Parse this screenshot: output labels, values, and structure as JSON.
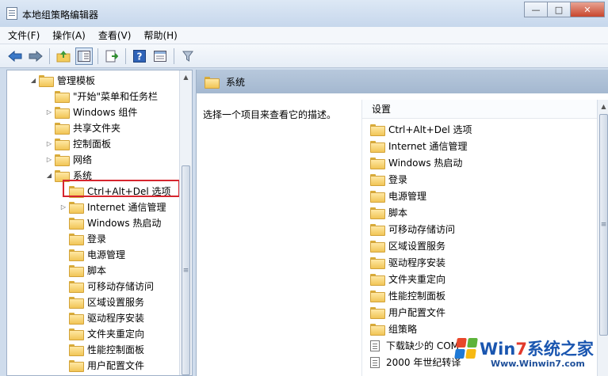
{
  "window": {
    "title": "本地组策略编辑器",
    "minimize_glyph": "—",
    "maximize_glyph": "□",
    "close_glyph": "✕"
  },
  "menu": [
    {
      "label": "文件(F)"
    },
    {
      "label": "操作(A)"
    },
    {
      "label": "查看(V)"
    },
    {
      "label": "帮助(H)"
    }
  ],
  "toolbar": {
    "icons": [
      "back-icon",
      "forward-icon",
      "up-folder-icon",
      "show-hide-tree-icon",
      "export-list-icon",
      "help-icon",
      "properties-icon",
      "filter-icon"
    ]
  },
  "tree": [
    {
      "label": "管理模板",
      "level": 0,
      "expander": "◢"
    },
    {
      "label": "\"开始\"菜单和任务栏",
      "level": 1,
      "expander": ""
    },
    {
      "label": "Windows 组件",
      "level": 1,
      "expander": "▷"
    },
    {
      "label": "共享文件夹",
      "level": 1,
      "expander": ""
    },
    {
      "label": "控制面板",
      "level": 1,
      "expander": "▷"
    },
    {
      "label": "网络",
      "level": 1,
      "expander": "▷"
    },
    {
      "label": "系统",
      "level": 1,
      "expander": "◢"
    },
    {
      "label": "Ctrl+Alt+Del 选项",
      "level": 2,
      "expander": "",
      "highlighted": true
    },
    {
      "label": "Internet 通信管理",
      "level": 2,
      "expander": "▷"
    },
    {
      "label": "Windows 热启动",
      "level": 2,
      "expander": ""
    },
    {
      "label": "登录",
      "level": 2,
      "expander": ""
    },
    {
      "label": "电源管理",
      "level": 2,
      "expander": ""
    },
    {
      "label": "脚本",
      "level": 2,
      "expander": ""
    },
    {
      "label": "可移动存储访问",
      "level": 2,
      "expander": ""
    },
    {
      "label": "区域设置服务",
      "level": 2,
      "expander": ""
    },
    {
      "label": "驱动程序安装",
      "level": 2,
      "expander": ""
    },
    {
      "label": "文件夹重定向",
      "level": 2,
      "expander": ""
    },
    {
      "label": "性能控制面板",
      "level": 2,
      "expander": ""
    },
    {
      "label": "用户配置文件",
      "level": 2,
      "expander": ""
    }
  ],
  "right_pane": {
    "header": "系统",
    "description": "选择一个项目来查看它的描述。",
    "column_header": "设置",
    "items": [
      {
        "label": "Ctrl+Alt+Del 选项",
        "icon": "folder"
      },
      {
        "label": "Internet 通信管理",
        "icon": "folder"
      },
      {
        "label": "Windows 热启动",
        "icon": "folder"
      },
      {
        "label": "登录",
        "icon": "folder"
      },
      {
        "label": "电源管理",
        "icon": "folder"
      },
      {
        "label": "脚本",
        "icon": "folder"
      },
      {
        "label": "可移动存储访问",
        "icon": "folder"
      },
      {
        "label": "区域设置服务",
        "icon": "folder"
      },
      {
        "label": "驱动程序安装",
        "icon": "folder"
      },
      {
        "label": "文件夹重定向",
        "icon": "folder"
      },
      {
        "label": "性能控制面板",
        "icon": "folder"
      },
      {
        "label": "用户配置文件",
        "icon": "folder"
      },
      {
        "label": "组策略",
        "icon": "folder"
      },
      {
        "label": "下载缺少的 COM",
        "icon": "setting"
      },
      {
        "label": "2000 年世纪转译",
        "icon": "setting"
      }
    ]
  },
  "watermark": {
    "brand_prefix": "Win",
    "brand_digit": "7",
    "brand_suffix": "系统之家",
    "url": "Www.Winwin7.com"
  },
  "colors": {
    "highlight_border": "#d6252e",
    "header_bg": "#b7c8dc"
  }
}
